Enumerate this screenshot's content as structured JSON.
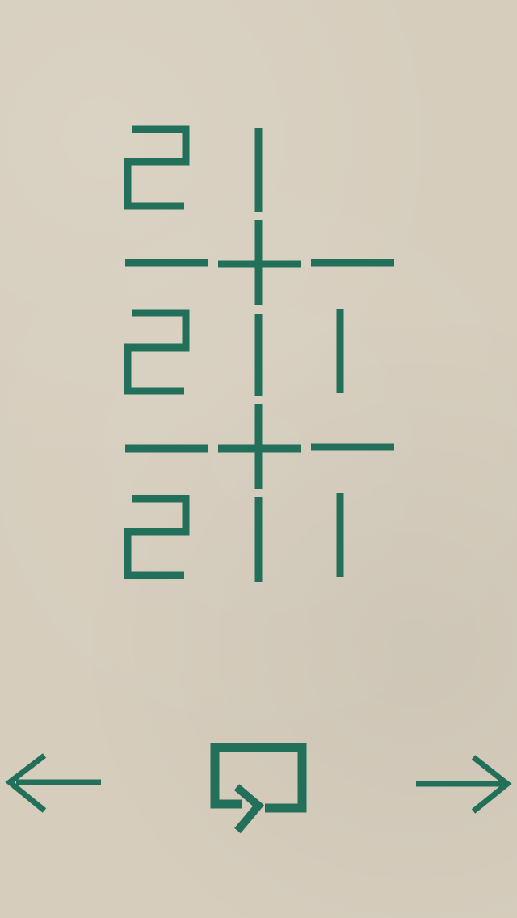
{
  "colors": {
    "background": "#d6cdbd",
    "ink": "#23705a"
  },
  "puzzle": {
    "rows": [
      {
        "clue": "2",
        "cells": [
          "1",
          ""
        ]
      },
      {
        "clue": "2",
        "cells": [
          "1",
          "1"
        ]
      },
      {
        "clue": "2",
        "cells": [
          "1",
          "1"
        ]
      }
    ]
  },
  "controls": {
    "prev_icon": "arrow-left-icon",
    "restart_icon": "restart-icon",
    "next_icon": "arrow-right-icon"
  }
}
